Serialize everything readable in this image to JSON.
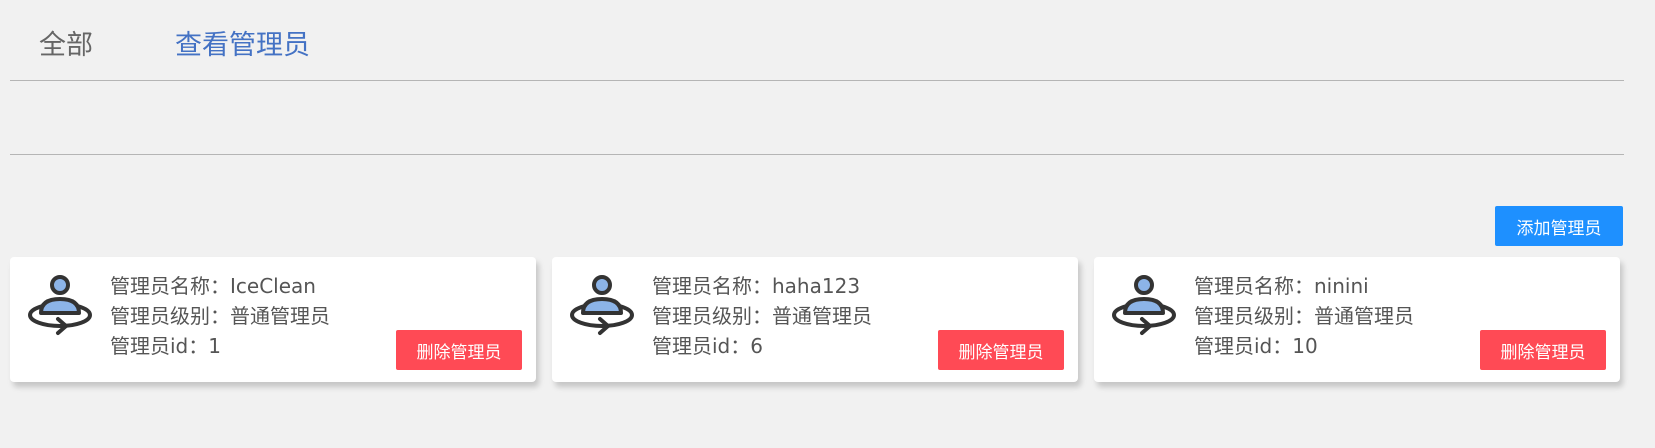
{
  "tabs": [
    {
      "label": "全部"
    },
    {
      "label": "查看管理员"
    }
  ],
  "toolbar": {
    "add_label": "添加管理员"
  },
  "labels": {
    "name": "管理员名称：",
    "level": "管理员级别：",
    "id": "管理员id："
  },
  "admins": [
    {
      "name": "IceClean",
      "level": "普通管理员",
      "id": "1",
      "delete_label": "删除管理员"
    },
    {
      "name": "haha123",
      "level": "普通管理员",
      "id": "6",
      "delete_label": "删除管理员"
    },
    {
      "name": "ninini",
      "level": "普通管理员",
      "id": "10",
      "delete_label": "删除管理员"
    }
  ],
  "icons": {
    "avatar": "admin-user-icon"
  },
  "colors": {
    "active_tab": "#4472c4",
    "add_button": "#1e90ff",
    "delete_button": "#ff4a55",
    "background": "#f1f1f1"
  }
}
